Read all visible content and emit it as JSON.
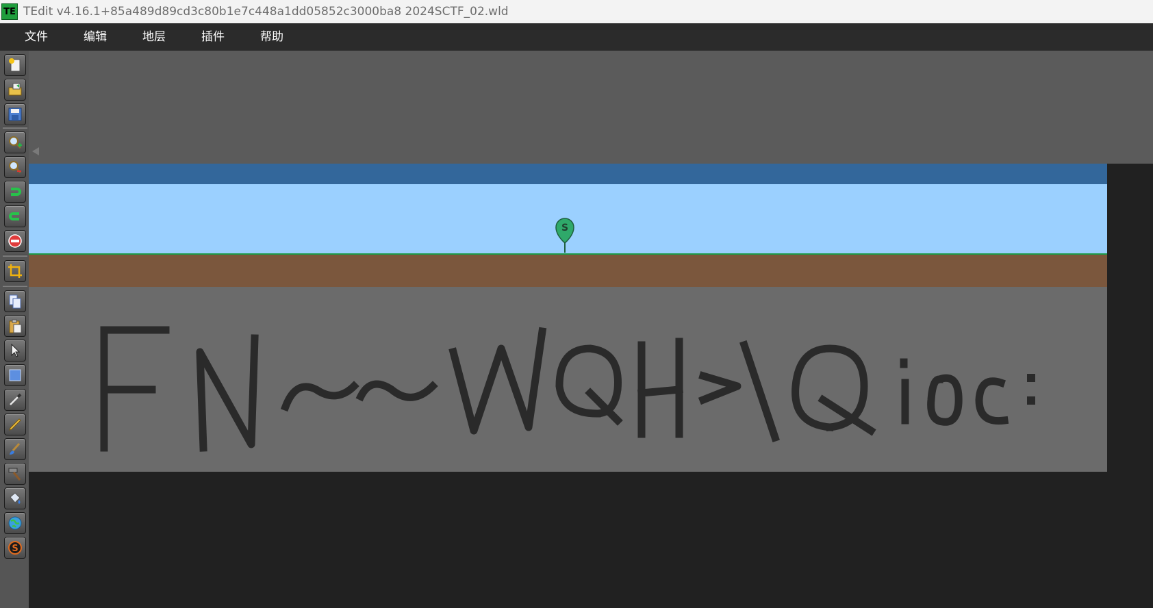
{
  "window": {
    "app_icon_text": "TE",
    "title": "TEdit v4.16.1+85a489d89cd3c80b1e7c448a1dd05852c3000ba8 2024SCTF_02.wld"
  },
  "menu": {
    "items": [
      "文件",
      "编辑",
      "地层",
      "插件",
      "帮助"
    ]
  },
  "toolbar": {
    "tools": [
      "new-world-icon",
      "open-world-icon",
      "save-world-icon",
      "zoom-in-icon",
      "zoom-out-icon",
      "undo-icon",
      "redo-icon",
      "delete-icon",
      "crop-icon",
      "copy-icon",
      "paste-icon",
      "arrow-select-icon",
      "rectangle-select-icon",
      "picker-icon",
      "pencil-icon",
      "brush-icon",
      "hammer-icon",
      "fill-bucket-icon",
      "morph-globe-icon",
      "sprite-icon"
    ]
  },
  "world": {
    "spawn_label": "S",
    "stone_drawing_text": "FN~~WQH>\\Qioc:",
    "colors": {
      "space": "#33679b",
      "sky": "#9bd0ff",
      "grass": "#1d9a48",
      "dirt": "#7b573d",
      "stone": "#6b6b6b",
      "drawing": "#2a2a2a",
      "spawn": "#2fa96a"
    }
  }
}
